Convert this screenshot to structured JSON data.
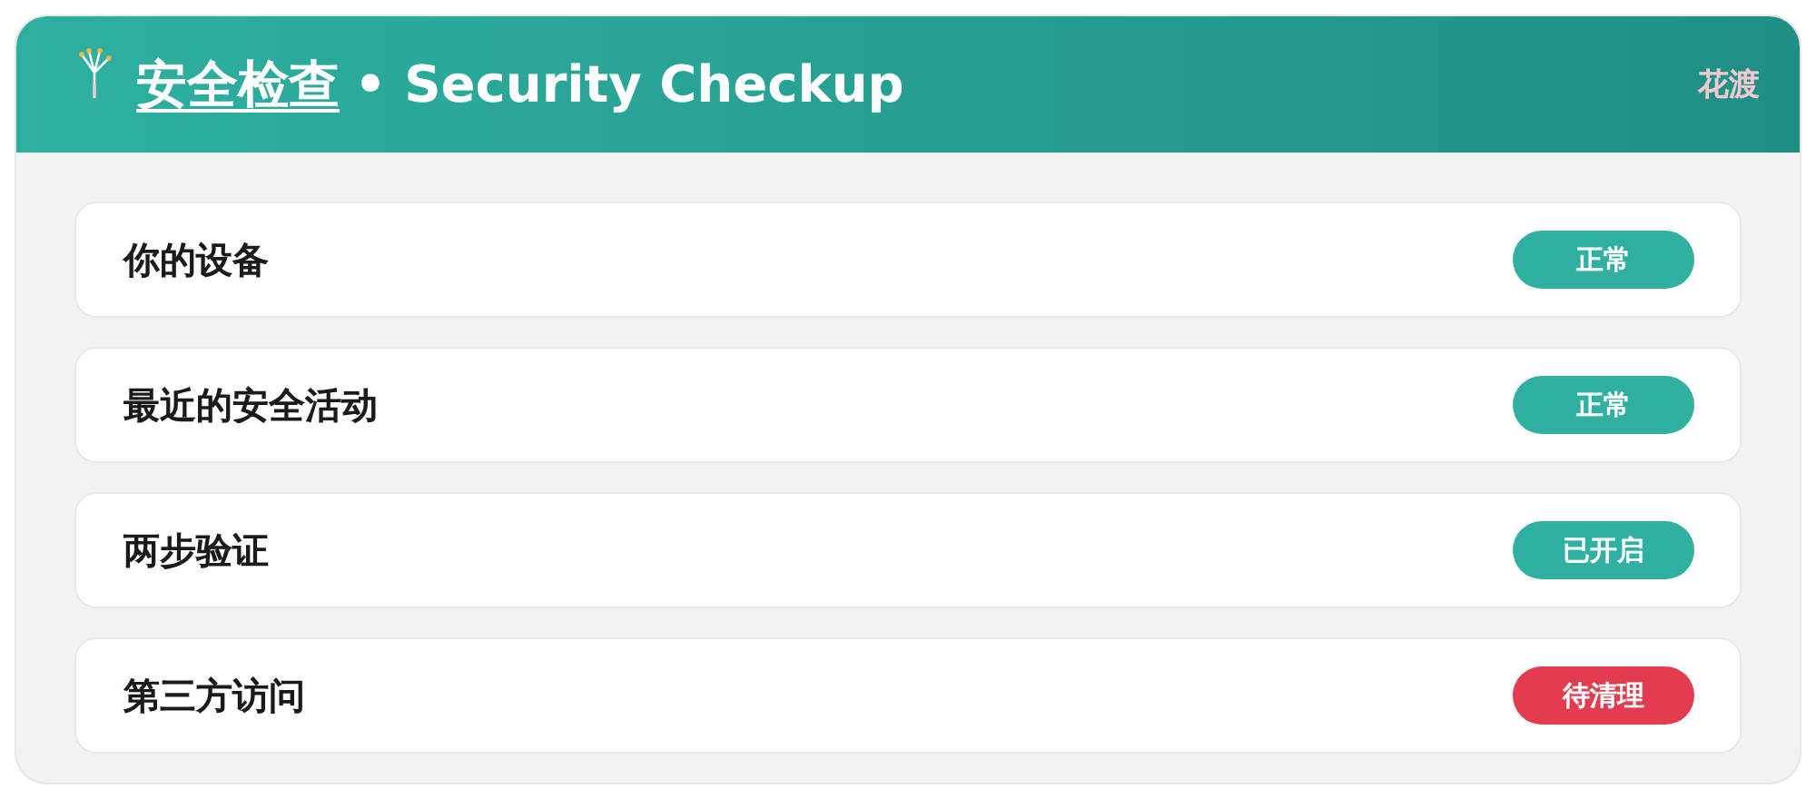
{
  "header": {
    "title_link": "安全检查",
    "title_rest": "• Security Checkup",
    "user": "花渡"
  },
  "items": [
    {
      "label": "你的设备",
      "status": "正常",
      "color": "#2fb0a0"
    },
    {
      "label": "最近的安全活动",
      "status": "正常",
      "color": "#2fb0a0"
    },
    {
      "label": "两步验证",
      "status": "已开启",
      "color": "#2fb0a0"
    },
    {
      "label": "第三方访问",
      "status": "待清理",
      "color": "#e33b50"
    }
  ]
}
